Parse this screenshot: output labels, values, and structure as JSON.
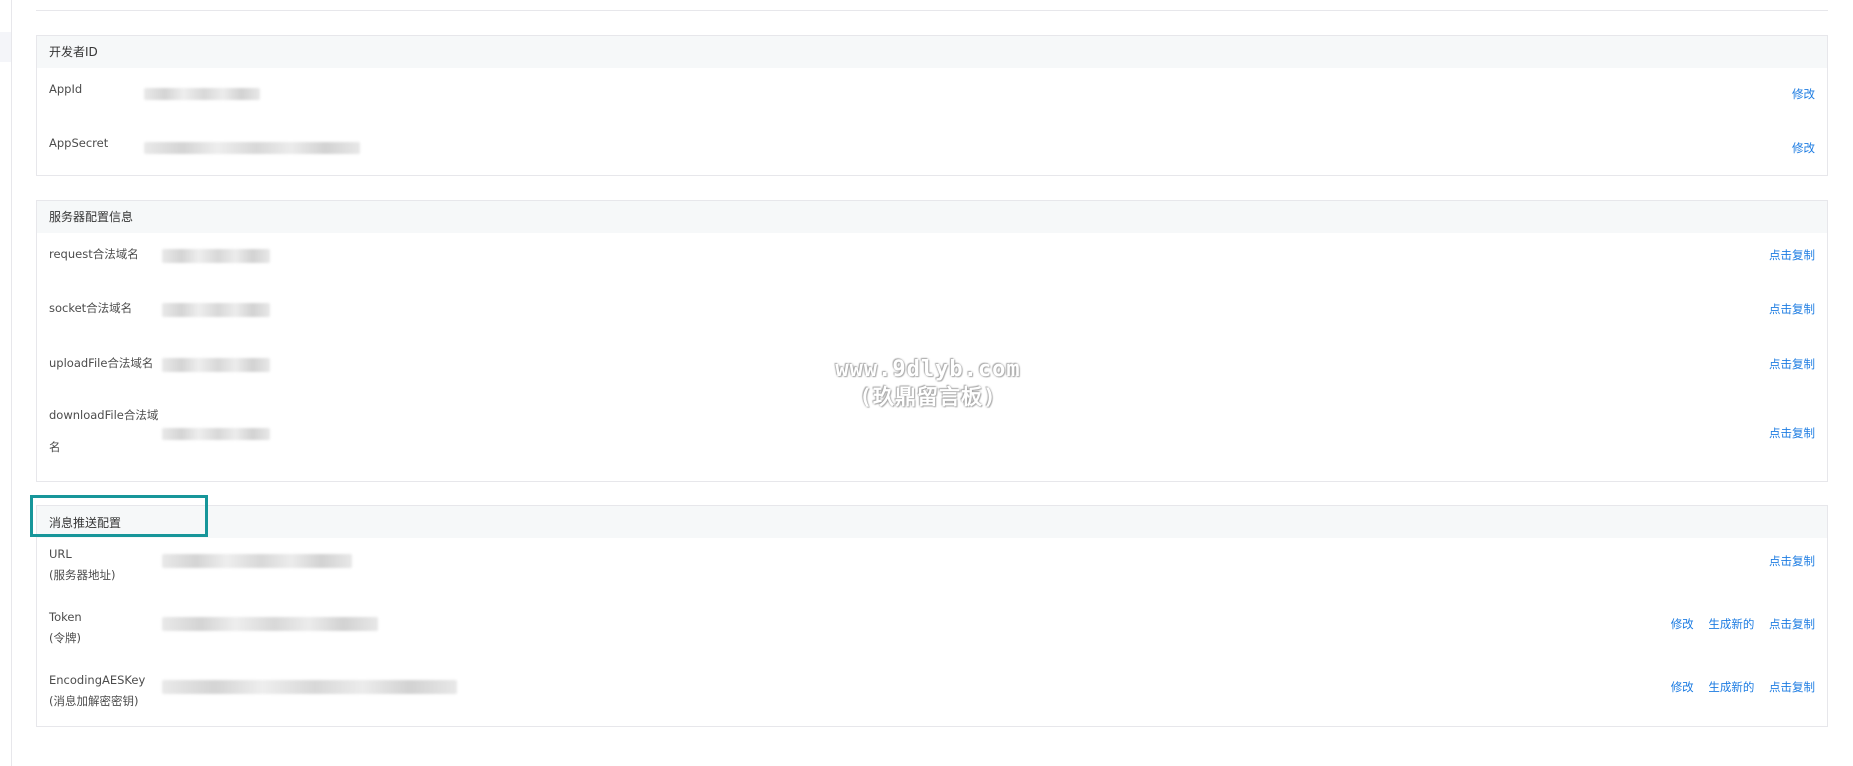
{
  "sections": {
    "developer": {
      "header": "开发者ID",
      "rows": [
        {
          "label": "AppId",
          "actions": [
            "修改"
          ]
        },
        {
          "label": "AppSecret",
          "actions": [
            "修改"
          ]
        }
      ]
    },
    "server": {
      "header": "服务器配置信息",
      "rows": [
        {
          "label": "request合法域名",
          "actions": [
            "点击复制"
          ]
        },
        {
          "label": "socket合法域名",
          "actions": [
            "点击复制"
          ]
        },
        {
          "label": "uploadFile合法域名",
          "actions": [
            "点击复制"
          ]
        },
        {
          "label_line1": "downloadFile合法域",
          "label_line2": "名",
          "actions": [
            "点击复制"
          ]
        }
      ]
    },
    "message": {
      "header": "消息推送配置",
      "rows": [
        {
          "label_line1": "URL",
          "label_line2": "(服务器地址)",
          "actions": [
            "点击复制"
          ]
        },
        {
          "label_line1": "Token",
          "label_line2": "(令牌)",
          "actions": [
            "修改",
            "生成新的",
            "点击复制"
          ]
        },
        {
          "label_line1": "EncodingAESKey",
          "label_line2": "(消息加解密密钥)",
          "actions": [
            "修改",
            "生成新的",
            "点击复制"
          ]
        }
      ]
    }
  },
  "watermark": {
    "line1": "www.9dlyb.com",
    "line2": "(玖鼎留言板)"
  },
  "colors": {
    "link": "#1d7ce2",
    "highlight_border": "#17969a",
    "section_header_bg": "#f6f8f9",
    "border": "#e7e7eb"
  }
}
